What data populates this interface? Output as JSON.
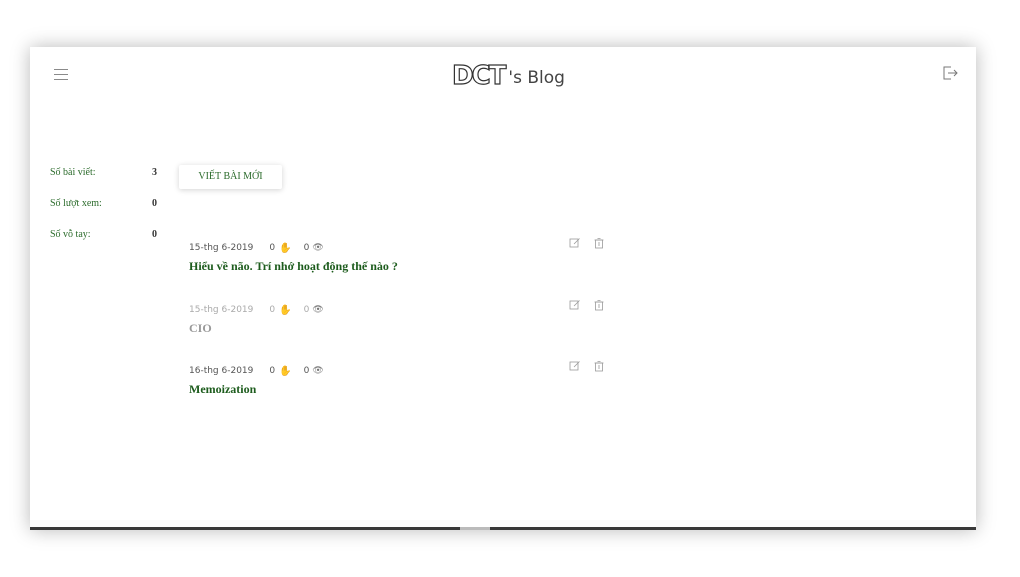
{
  "header": {
    "logo_mark": "DCT",
    "logo_suffix": "'s Blog"
  },
  "icons": {
    "menu": "hamburger-menu-icon",
    "logout": "logout-icon",
    "edit": "edit-icon",
    "delete": "trash-icon",
    "clap": "clap-icon",
    "view": "eye-icon"
  },
  "stats": [
    {
      "label": "Số bài viết:",
      "value": "3"
    },
    {
      "label": "Số lượt xem:",
      "value": "0"
    },
    {
      "label": "Số vỗ tay:",
      "value": "0"
    }
  ],
  "new_post_button": "VIẾT BÀI MỚI",
  "posts": [
    {
      "date": "15-thg 6-2019",
      "claps": "0",
      "views": "0",
      "title": "Hiểu về não. Trí nhớ hoạt động thế nào ?"
    },
    {
      "date": "15-thg 6-2019",
      "claps": "0",
      "views": "0",
      "title": "CIO"
    },
    {
      "date": "16-thg 6-2019",
      "claps": "0",
      "views": "0",
      "title": "Memoization"
    }
  ],
  "colors": {
    "accent_green": "#1d5c1d",
    "muted": "#999999"
  }
}
